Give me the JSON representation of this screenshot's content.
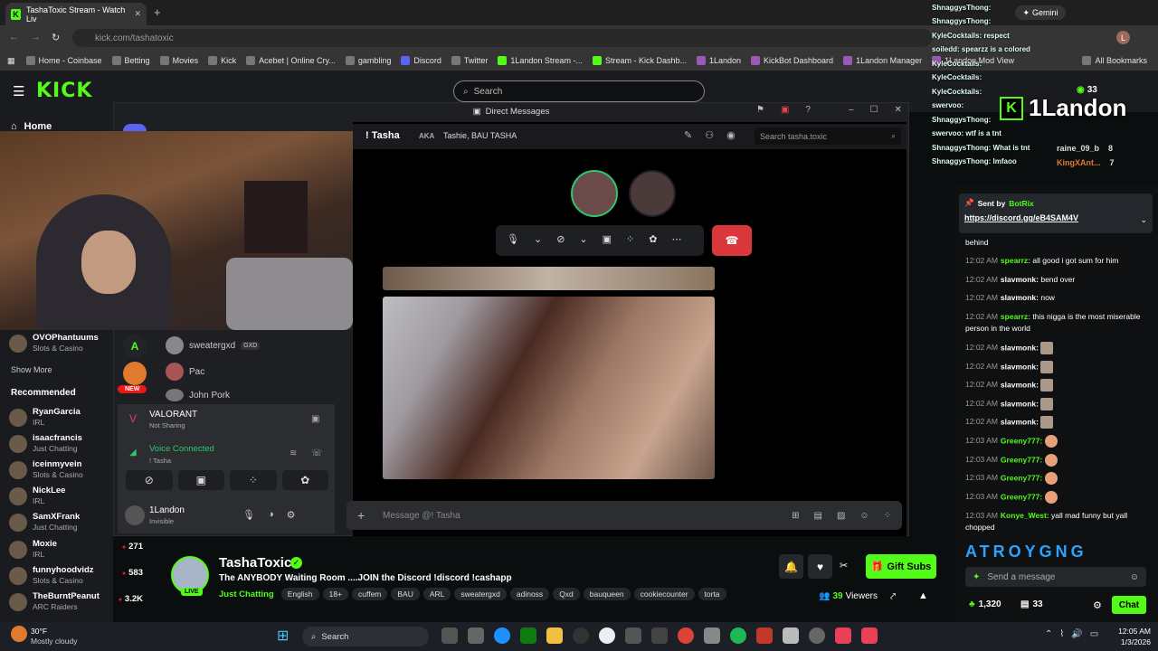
{
  "browser": {
    "tab_title": "TashaToxic Stream - Watch Liv",
    "url_host": "kick.com/",
    "url_path": "tashatoxic",
    "bookmarks": [
      "Home - Coinbase",
      "Betting",
      "Movies",
      "Kick",
      "Acebet | Online Cry...",
      "gambling",
      "Discord",
      "Twitter",
      "1Landon Stream -...",
      "Stream - Kick Dashb...",
      "1Landon",
      "KickBot Dashboard",
      "1Landon Manager",
      "1Landon Mod View"
    ],
    "all_bookmarks": "All Bookmarks",
    "gemini": "Gemini",
    "profile_initial": "L"
  },
  "kick": {
    "logo": "KICK",
    "search_placeholder": "Search",
    "home": "Home"
  },
  "sidebar": {
    "following_partial": [
      {
        "name": "OVOPhantuums",
        "category": "Slots & Casino"
      }
    ],
    "show_more": "Show More",
    "recommended_title": "Recommended",
    "recommended": [
      {
        "name": "RyanGarcia",
        "category": "IRL",
        "viewers": ""
      },
      {
        "name": "isaacfrancis",
        "category": "Just Chatting",
        "viewers": ""
      },
      {
        "name": "iceinmyvein",
        "category": "Slots & Casino",
        "viewers": ""
      },
      {
        "name": "NickLee",
        "category": "IRL",
        "viewers": ""
      },
      {
        "name": "SamXFrank",
        "category": "Just Chatting",
        "viewers": ""
      },
      {
        "name": "Moxie",
        "category": "IRL",
        "viewers": "271"
      },
      {
        "name": "funnyhoodvidz",
        "category": "Slots & Casino",
        "viewers": "583"
      },
      {
        "name": "TheBurntPeanut",
        "category": "ARC Raiders",
        "viewers": "3.2K"
      }
    ]
  },
  "discord": {
    "window_title": "Direct Messages",
    "dm_name": "! Tasha",
    "aka_label": "AKA",
    "aka_names": "Tashie, BAU TASHA",
    "search_placeholder": "Search tasha.toxic",
    "members": [
      {
        "name": "sweatergxd",
        "tag": "GXD"
      },
      {
        "name": "Pac",
        "tag": ""
      },
      {
        "name": "John Pork",
        "tag": ""
      }
    ],
    "new_badge": "NEW",
    "activity_game": "VALORANT",
    "activity_status": "Not Sharing",
    "voice_status": "Voice Connected",
    "voice_channel": "! Tasha",
    "user_name": "1Landon",
    "user_status": "Invisible",
    "message_placeholder": "Message @! Tasha"
  },
  "stream": {
    "streamer": "TashaToxic",
    "title": "The ANYBODY Waiting Room ....JOIN the Discord !discord !cashapp",
    "category": "Just Chatting",
    "tags": [
      "English",
      "18+",
      "cuffem",
      "BAU",
      "ARL",
      "sweatergxd",
      "adinoss",
      "Qxd",
      "bauqueen",
      "cookiecounter",
      "torta"
    ],
    "live_label": "LIVE",
    "viewers": "39",
    "viewers_label": "Viewers",
    "gift_subs": "Gift Subs"
  },
  "chat": {
    "pinned_sent_by": "Sent by",
    "pinned_sender": "BotRix",
    "pinned_link": "https://discord.gg/eB4SAM4V",
    "messages": [
      {
        "time": "",
        "user": "",
        "text": "behind"
      },
      {
        "time": "12:02 AM",
        "user": "spearrz:",
        "text": "all good i got sum for him"
      },
      {
        "time": "12:02 AM",
        "user": "slavmonk:",
        "text": "bend over"
      },
      {
        "time": "12:02 AM",
        "user": "slavmonk:",
        "text": "now"
      },
      {
        "time": "12:02 AM",
        "user": "spearrz:",
        "text": "this nigga is the most miserable person in the world"
      },
      {
        "time": "12:02 AM",
        "user": "slavmonk:",
        "text": ""
      },
      {
        "time": "12:02 AM",
        "user": "slavmonk:",
        "text": ""
      },
      {
        "time": "12:02 AM",
        "user": "slavmonk:",
        "text": ""
      },
      {
        "time": "12:02 AM",
        "user": "slavmonk:",
        "text": ""
      },
      {
        "time": "12:02 AM",
        "user": "slavmonk:",
        "text": ""
      },
      {
        "time": "12:03 AM",
        "user": "Greeny777:",
        "text": ""
      },
      {
        "time": "12:03 AM",
        "user": "Greeny777:",
        "text": ""
      },
      {
        "time": "12:03 AM",
        "user": "Greeny777:",
        "text": ""
      },
      {
        "time": "12:03 AM",
        "user": "Greeny777:",
        "text": ""
      },
      {
        "time": "12:03 AM",
        "user": "Konye_West:",
        "text": "yall mad funny but yall chopped"
      }
    ],
    "banner_letters": "ATROYGNG",
    "send_placeholder": "Send a message",
    "points": "1,320",
    "gifts": "33",
    "chat_button": "Chat"
  },
  "overlay": {
    "lines": [
      "ShnaggysThong:",
      "ShnaggysThong:",
      "KyleCocktails: respect",
      "soiledd: spearzz is a colored",
      "KyleCocktails:",
      "KyleCocktails:",
      "KyleCocktails:",
      "swervoo:",
      "ShnaggysThong:",
      "swervoo: wtf is a tnt",
      "ShnaggysThong: What is tnt",
      "ShnaggysThong: lmfaoo"
    ],
    "badge": "1Landon",
    "viewer_count": "33",
    "leaderboard": [
      {
        "name": "raine_09_b",
        "value": "8"
      },
      {
        "name": "KingXAnt...",
        "value": "7"
      }
    ]
  },
  "taskbar": {
    "weather_temp": "30°F",
    "weather_desc": "Mostly cloudy",
    "search": "Search",
    "time": "12:05 AM",
    "date": "1/3/2026"
  }
}
